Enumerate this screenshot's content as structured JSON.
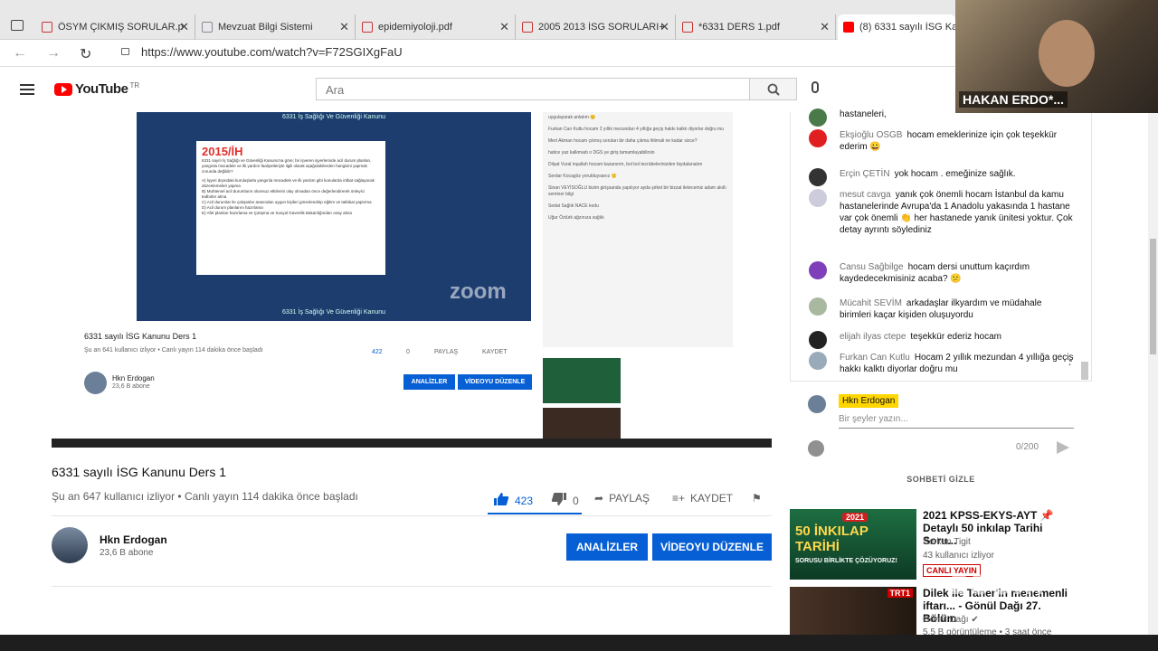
{
  "tabs": [
    {
      "label": "ÖSYM ÇIKMIŞ SORULAR.p"
    },
    {
      "label": "Mevzuat Bilgi Sistemi"
    },
    {
      "label": "epidemiyoloji.pdf"
    },
    {
      "label": "2005 2013 İSG SORULARI+"
    },
    {
      "label": "*6331 DERS 1.pdf"
    },
    {
      "label": "(8) 6331 sayılı İSG Kanu"
    }
  ],
  "address": {
    "url": "https://www.youtube.com/watch?v=F72SGIXgFaU"
  },
  "youtube": {
    "logo": "YouTube",
    "region": "TR",
    "search_placeholder": "Ara"
  },
  "video": {
    "title": "6331 sayılı İSG Kanunu Ders 1",
    "meta": "Şu an 647 kullanıcı izliyor • Canlı yayın 114 dakika önce başladı",
    "likes": "423",
    "dislikes": "0",
    "share": "PAYLAŞ",
    "save": "KAYDET",
    "channel": "Hkn Erdogan",
    "subscribers": "23,6 B abone",
    "analytics": "ANALİZLER",
    "edit": "VİDEOYU DÜZENLE"
  },
  "screen_share": {
    "slide_header": "6331 İş Sağlığı Ve Güvenliği Kanunu",
    "slide_footer": "6331 İş Sağlığı Ve Güvenliği Kanunu",
    "slide_title": "2015/İH",
    "inner_title": "6331 sayılı İSG Kanunu Ders 1",
    "inner_meta": "Şu an 641 kullanıcı izliyor • Canlı yayın 114 dakika önce başladı",
    "inner_likes": "422",
    "inner_dislikes": "0",
    "inner_share": "PAYLAŞ",
    "inner_save": "KAYDET",
    "inner_channel": "Hkn Erdogan",
    "inner_subs": "23,6 B abone",
    "inner_analytics": "ANALİZLER",
    "inner_edit": "VİDEOYU DÜZENLE",
    "zoom_text": "zoom"
  },
  "chat": {
    "messages": [
      {
        "author": "",
        "text": "hastaneleri,"
      },
      {
        "author": "Ekşioğlu OSGB",
        "text": "hocam emeklerinize için çok teşekkür ederim 😀"
      },
      {
        "author": "Erçin ÇETİN",
        "text": "yok hocam . emeğinize sağlık."
      },
      {
        "author": "mesut cavga",
        "text": "yanık çok önemli hocam İstanbul da kamu hastanelerinde Avrupa'da 1 Anadolu yakasında 1 hastane var çok önemli 👏 her hastanede yanık ünitesi yoktur. Çok detay ayrıntı söylediniz"
      },
      {
        "author": "Cansu Sağbilge",
        "text": "hocam dersi unuttum kaçırdım kaydedecekmisiniz acaba? 😕"
      },
      {
        "author": "Mücahit SEVİM",
        "text": "arkadaşlar ilkyardım ve müdahale birimleri kaçar kişiden oluşuyordu"
      },
      {
        "author": "elijah ilyas ctepe",
        "text": "teşekkür ederiz hocam"
      },
      {
        "author": "Furkan Can Kutlu",
        "text": "Hocam 2 yıllık mezundan 4 yıllığa geçiş hakkı kalktı diyorlar doğru mu"
      }
    ],
    "me": "Hkn Erdogan",
    "placeholder": "Bir şeyler yazın...",
    "counter": "0/200",
    "hide": "SOHBETİ GİZLE"
  },
  "recommended": [
    {
      "title": "2021 KPSS-EKYS-AYT 📌 Detaylı 50 inkılap Tarihi Soru...",
      "channel": "Serkan Tigit",
      "views": "43 kullanıcı izliyor",
      "badge": "CANLI YAYIN",
      "thumb_text": "50 İNKILAP TARİHİ",
      "thumb_sub": "SORUSU BİRLİKTE ÇÖZÜYORUZ!",
      "thumb_year": "2021"
    },
    {
      "title": "Dilek ile Taner'in menemenli iftarı... - Gönül Dağı 27. Bölüm",
      "channel": "Gönül Dağı ✔",
      "views": "5,5 B görüntüleme • 3 saat önce",
      "badge": "",
      "thumb_text": "TRT1"
    }
  ],
  "camera": {
    "name": "HAKAN ERDO*..."
  },
  "colors": {
    "accent": "#065fd4",
    "yt_red": "#ff0000",
    "slide_bg": "#1e3d6f",
    "highlight": "#ffd600"
  }
}
